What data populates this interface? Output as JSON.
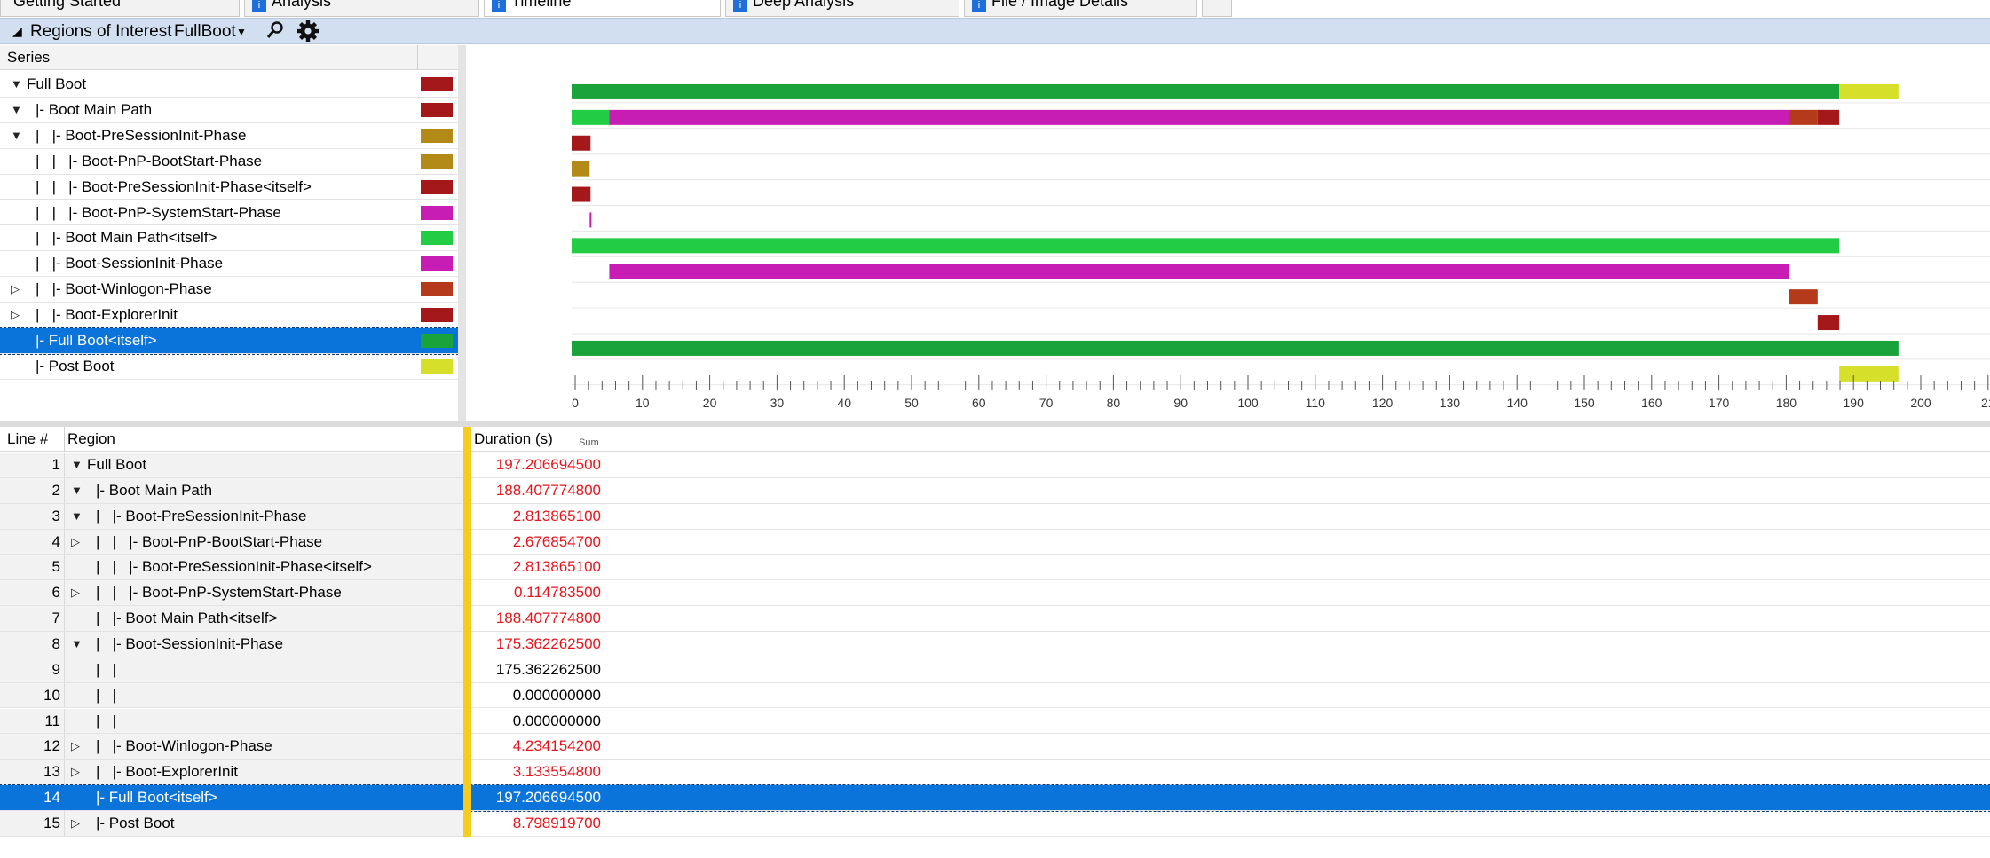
{
  "tabs": [
    {
      "label": "Getting Started",
      "icon": "none"
    },
    {
      "label": "Analysis",
      "icon": "analysis-tab-icon"
    },
    {
      "label": "Timeline",
      "icon": "timeline-tab-icon"
    },
    {
      "label": "Deep Analysis",
      "icon": "deep-analysis-tab-icon"
    },
    {
      "label": "File / Image Details",
      "icon": "file-details-tab-icon"
    }
  ],
  "roi": {
    "label": "Regions of Interest",
    "selected": "FullBoot"
  },
  "series_panel": {
    "header": "Series",
    "items": [
      {
        "label": "Full Boot",
        "color": "#a5181a",
        "expander": "open"
      },
      {
        "label": "|- Boot Main Path",
        "color": "#a5181a",
        "expander": "open"
      },
      {
        "label": "|   |- Boot-PreSessionInit-Phase",
        "color": "#b38a17",
        "expander": "open"
      },
      {
        "label": "|   |   |- Boot-PnP-BootStart-Phase",
        "color": "#b38a17",
        "expander": ""
      },
      {
        "label": "|   |   |- Boot-PreSessionInit-Phase<itself>",
        "color": "#a5181a",
        "expander": ""
      },
      {
        "label": "|   |   |- Boot-PnP-SystemStart-Phase",
        "color": "#c71db5",
        "expander": ""
      },
      {
        "label": "|   |- Boot Main Path<itself>",
        "color": "#22cc44",
        "expander": ""
      },
      {
        "label": "|   |- Boot-SessionInit-Phase",
        "color": "#c71db5",
        "expander": ""
      },
      {
        "label": "|   |- Boot-Winlogon-Phase",
        "color": "#b5391b",
        "expander": "closed"
      },
      {
        "label": "|   |- Boot-ExplorerInit",
        "color": "#a5181a",
        "expander": "closed"
      },
      {
        "label": "|- Full Boot<itself>",
        "color": "#1aa33a",
        "expander": "",
        "selected": true
      },
      {
        "label": "|- Post Boot",
        "color": "#d6e02a",
        "expander": ""
      }
    ]
  },
  "chart_data": {
    "type": "bar",
    "subtype": "gantt",
    "x_unit": "seconds",
    "xlim": [
      0,
      210
    ],
    "x_ticks": [
      0,
      10,
      20,
      30,
      40,
      50,
      60,
      70,
      80,
      90,
      100,
      110,
      120,
      130,
      140,
      150,
      160,
      170,
      180,
      190,
      200,
      210
    ],
    "x_tick_labels": [
      "0",
      "10",
      "20",
      "30",
      "40",
      "50",
      "60",
      "70",
      "80",
      "90",
      "100",
      "110",
      "120",
      "130",
      "140",
      "150",
      "160",
      "170",
      "180",
      "190",
      "200",
      "21"
    ],
    "rows": [
      {
        "segments": [
          {
            "start": 0,
            "end": 188.41,
            "color": "#1aa33a"
          },
          {
            "start": 188.41,
            "end": 197.21,
            "color": "#d6e02a"
          }
        ]
      },
      {
        "segments": [
          {
            "start": 0,
            "end": 5.6,
            "color": "#22cc44"
          },
          {
            "start": 5.6,
            "end": 181.0,
            "color": "#c71db5"
          },
          {
            "start": 181.0,
            "end": 185.2,
            "color": "#b5391b"
          },
          {
            "start": 185.2,
            "end": 188.41,
            "color": "#a5181a"
          }
        ]
      },
      {
        "segments": [
          {
            "start": 0,
            "end": 2.81,
            "color": "#a5181a"
          }
        ]
      },
      {
        "segments": [
          {
            "start": 0,
            "end": 2.68,
            "color": "#b38a17"
          }
        ]
      },
      {
        "segments": [
          {
            "start": 0,
            "end": 2.81,
            "color": "#a5181a"
          }
        ]
      },
      {
        "segments": [
          {
            "start": 2.68,
            "end": 2.79,
            "color": "#c71db5"
          }
        ]
      },
      {
        "segments": [
          {
            "start": 0,
            "end": 188.41,
            "color": "#22cc44"
          }
        ]
      },
      {
        "segments": [
          {
            "start": 5.6,
            "end": 181.0,
            "color": "#c71db5"
          }
        ]
      },
      {
        "segments": [
          {
            "start": 181.0,
            "end": 185.2,
            "color": "#b5391b"
          }
        ]
      },
      {
        "segments": [
          {
            "start": 185.2,
            "end": 188.41,
            "color": "#a5181a"
          }
        ]
      },
      {
        "segments": [
          {
            "start": 0,
            "end": 197.21,
            "color": "#1aa33a"
          }
        ]
      },
      {
        "segments": [
          {
            "start": 188.41,
            "end": 197.21,
            "color": "#d6e02a"
          }
        ]
      }
    ]
  },
  "table": {
    "headers": {
      "line": "Line #",
      "region": "Region",
      "duration": "Duration (s)",
      "duration_agg": "Sum"
    },
    "rows": [
      {
        "line": "1",
        "region": "Full Boot",
        "expander": "open",
        "duration": "197.206694500",
        "red": true
      },
      {
        "line": "2",
        "region": "|- Boot Main Path",
        "expander": "open",
        "duration": "188.407774800",
        "red": true
      },
      {
        "line": "3",
        "region": "|   |- Boot-PreSessionInit-Phase",
        "expander": "open",
        "duration": "2.813865100",
        "red": true
      },
      {
        "line": "4",
        "region": "|   |   |- Boot-PnP-BootStart-Phase",
        "expander": "closed",
        "duration": "2.676854700",
        "red": true
      },
      {
        "line": "5",
        "region": "|   |   |- Boot-PreSessionInit-Phase<itself>",
        "expander": "",
        "duration": "2.813865100",
        "red": true
      },
      {
        "line": "6",
        "region": "|   |   |- Boot-PnP-SystemStart-Phase",
        "expander": "closed",
        "duration": "0.114783500",
        "red": true
      },
      {
        "line": "7",
        "region": "|   |- Boot Main Path<itself>",
        "expander": "",
        "duration": "188.407774800",
        "red": true
      },
      {
        "line": "8",
        "region": "|   |- Boot-SessionInit-Phase",
        "expander": "open",
        "duration": "175.362262500",
        "red": true
      },
      {
        "line": "9",
        "region": "|   |",
        "expander": "",
        "duration": "175.362262500",
        "red": false
      },
      {
        "line": "10",
        "region": "|   |",
        "expander": "",
        "duration": "0.000000000",
        "red": false
      },
      {
        "line": "11",
        "region": "|   |",
        "expander": "",
        "duration": "0.000000000",
        "red": false
      },
      {
        "line": "12",
        "region": "|   |- Boot-Winlogon-Phase",
        "expander": "closed",
        "duration": "4.234154200",
        "red": true
      },
      {
        "line": "13",
        "region": "|   |- Boot-ExplorerInit",
        "expander": "closed",
        "duration": "3.133554800",
        "red": true
      },
      {
        "line": "14",
        "region": "|- Full Boot<itself>",
        "expander": "",
        "duration": "197.206694500",
        "red": false,
        "selected": true
      },
      {
        "line": "15",
        "region": "|- Post Boot",
        "expander": "closed",
        "duration": "8.798919700",
        "red": true
      }
    ]
  },
  "colors": {
    "accent": "#0a74da",
    "selection": "#0a74da",
    "roi_bar": "#d1dff0",
    "duration_red": "#e8141b",
    "divider_yellow": "#f5cc1f"
  }
}
